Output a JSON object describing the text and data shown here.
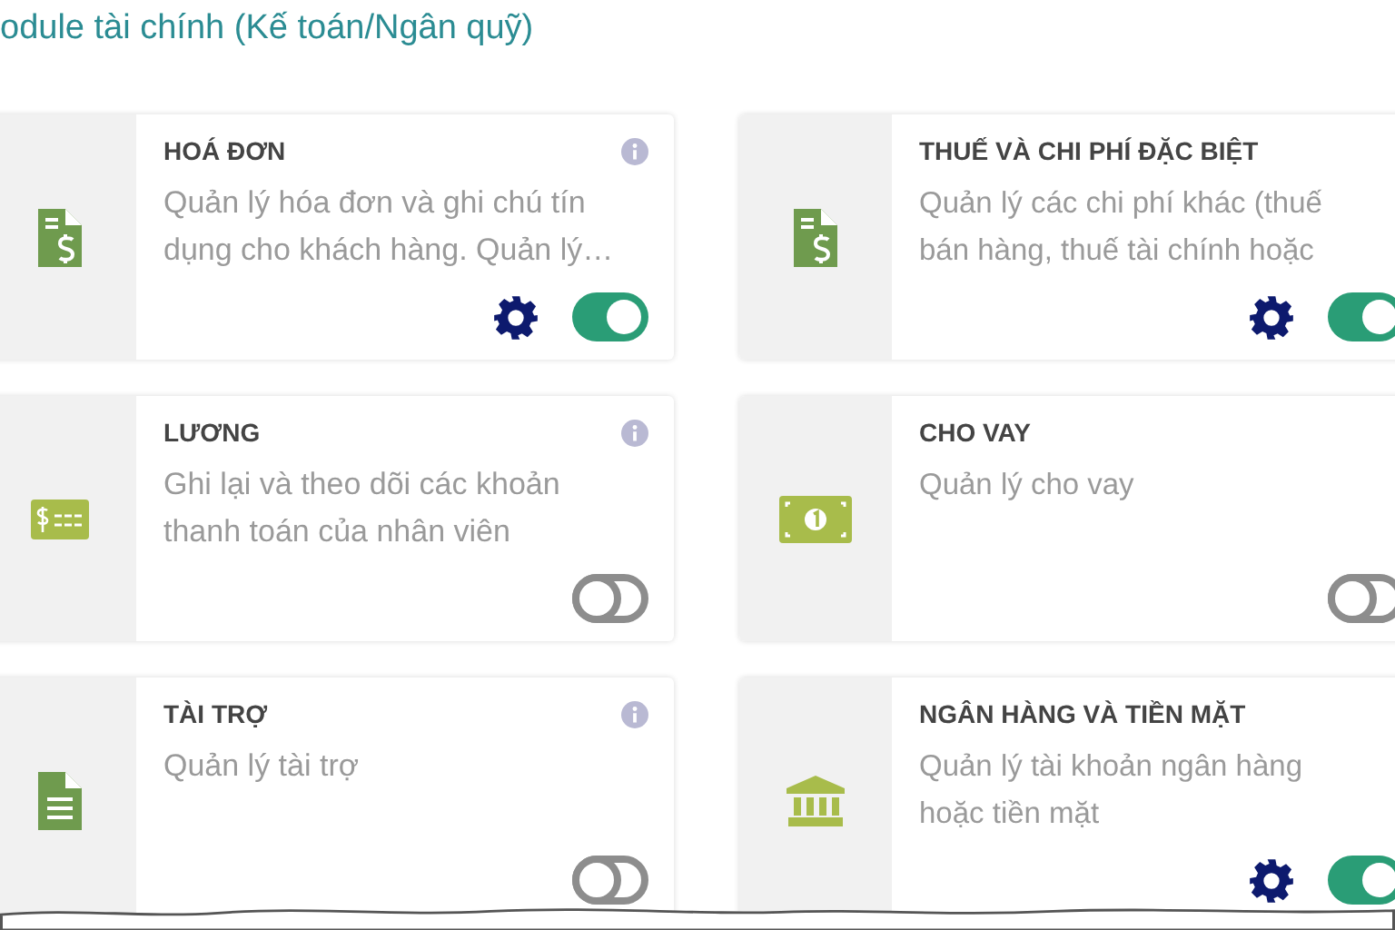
{
  "heading": "odule tài chính (Kế toán/Ngân quỹ)",
  "modules": [
    {
      "title": "HOÁ ĐƠN",
      "description": "Quản lý hóa đơn và ghi chú tín dụng cho khách hàng. Quản lý…",
      "kind": "invoice",
      "info": true,
      "settings": true,
      "enabled": true
    },
    {
      "title": "THUẾ VÀ CHI PHÍ ĐẶC BIỆT",
      "description": "Quản lý các chi phí khác (thuế bán hàng, thuế tài chính hoặc",
      "kind": "invoice",
      "info": false,
      "settings": true,
      "enabled": true
    },
    {
      "title": "LƯƠNG",
      "description": "Ghi lại và theo dõi các khoản thanh toán của nhân viên",
      "kind": "payroll",
      "info": true,
      "settings": false,
      "enabled": false
    },
    {
      "title": "CHO VAY",
      "description": "Quản lý cho vay",
      "kind": "loan",
      "info": false,
      "settings": false,
      "enabled": false
    },
    {
      "title": "TÀI TRỢ",
      "description": "Quản lý tài trợ",
      "kind": "document",
      "info": true,
      "settings": false,
      "enabled": false
    },
    {
      "title": "NGÂN HÀNG VÀ TIỀN MẶT",
      "description": "Quản lý tài khoản ngân hàng hoặc tiền mặt",
      "kind": "bank",
      "info": false,
      "settings": true,
      "enabled": true
    }
  ]
}
